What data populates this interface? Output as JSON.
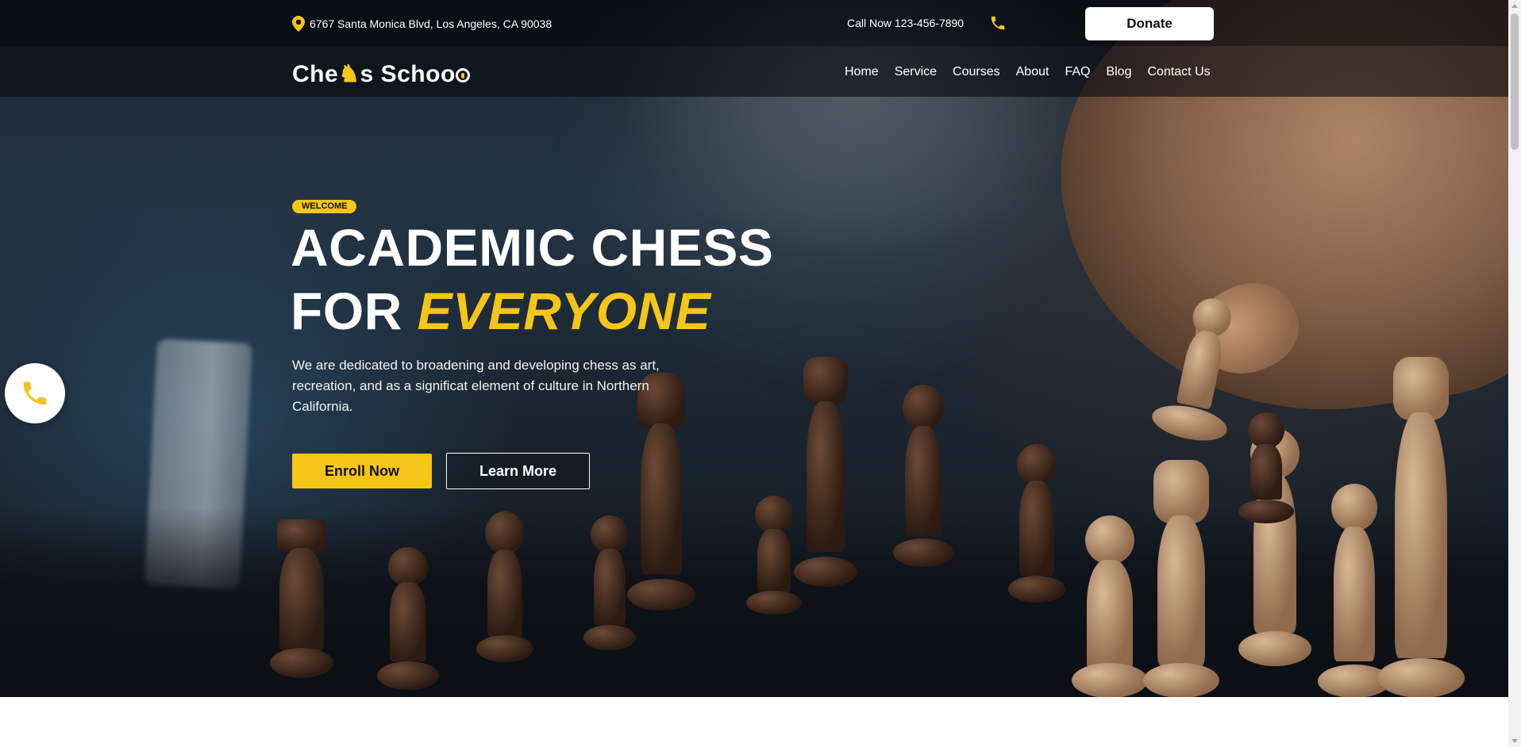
{
  "topbar": {
    "address": "6767 Santa Monica Blvd, Los Angeles, CA 90038",
    "call": "Call Now 123-456-7890",
    "donate_label": "Donate"
  },
  "logo": {
    "part1": "Che",
    "part2": "s Schoo"
  },
  "nav": {
    "items": [
      "Home",
      "Service",
      "Courses",
      "About",
      "FAQ",
      "Blog",
      "Contact Us"
    ]
  },
  "hero": {
    "badge": "WELCOME",
    "title_line1": "ACADEMIC CHESS",
    "title_line2_prefix": "FOR ",
    "title_line2_emphasis": "EVERYONE",
    "description": "We are dedicated to broadening and developing chess as art, recreation, and as a significat element of culture in Northern California.",
    "enroll_label": "Enroll Now",
    "learn_label": "Learn More"
  },
  "colors": {
    "accent": "#f5c518",
    "topbar": "#0a0d12",
    "text": "#ffffff"
  },
  "icons": {
    "address": "map-pin-icon",
    "call": "phone-icon",
    "float": "phone-icon"
  }
}
